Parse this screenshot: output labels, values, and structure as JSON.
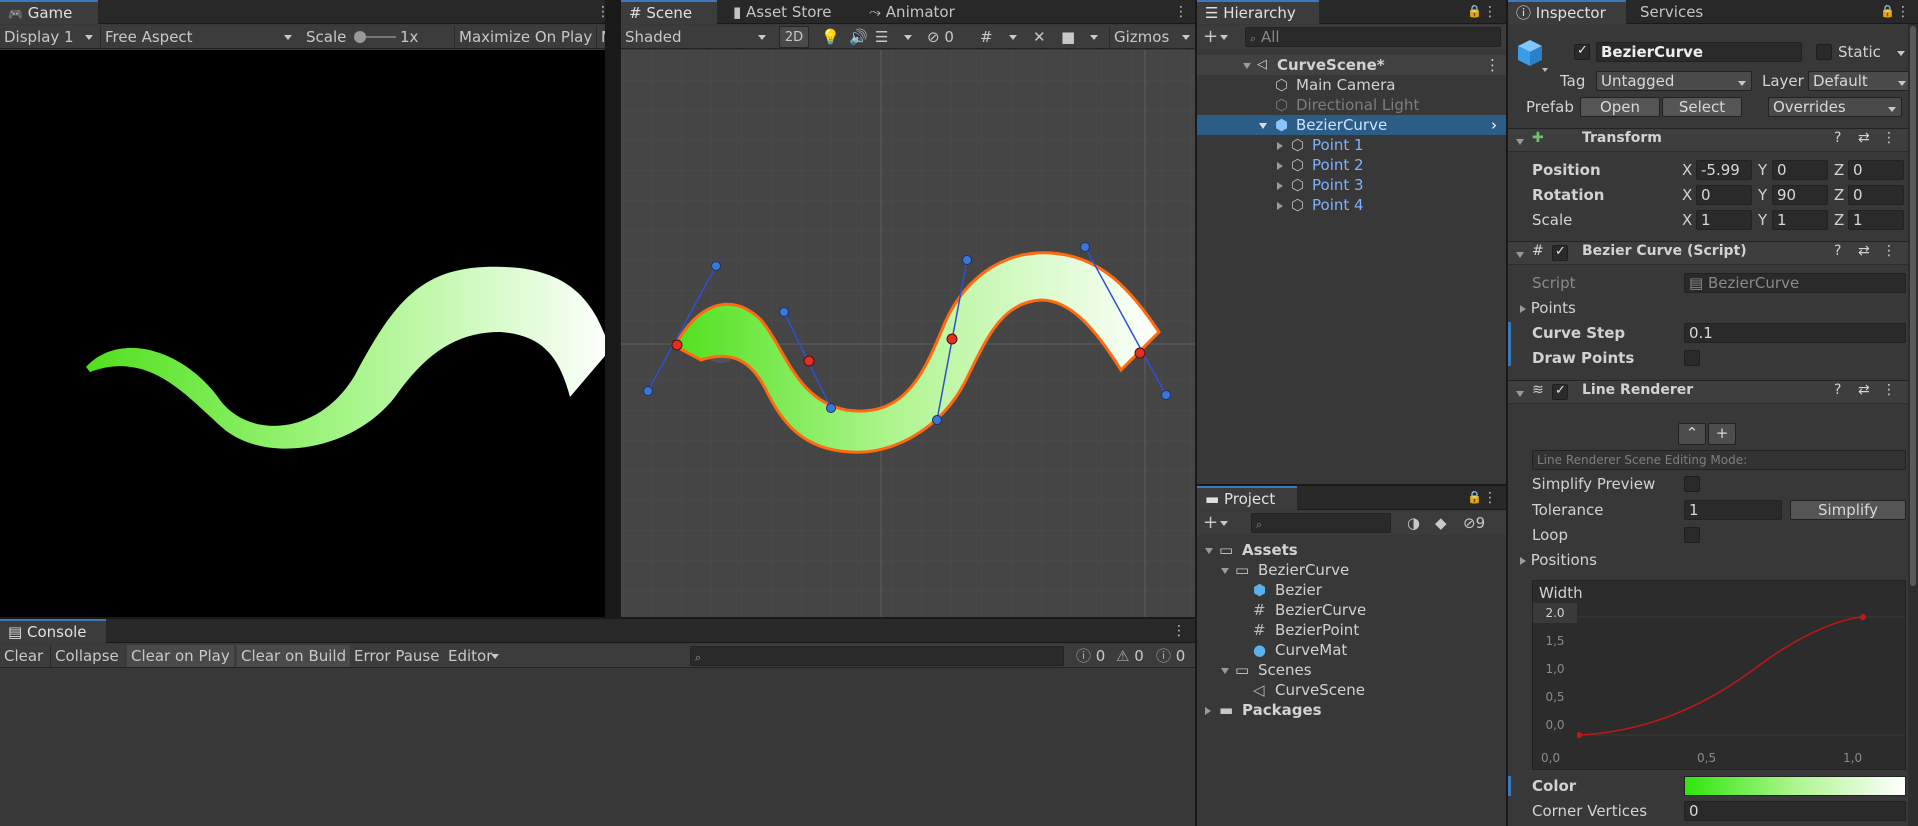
{
  "game": {
    "tab": "Game",
    "display": "Display 1",
    "aspect": "Free Aspect",
    "scale_label": "Scale",
    "scale_value": "1x",
    "maximize": "Maximize On Play",
    "mute_cut": "Mi"
  },
  "scene": {
    "tabs": [
      "Scene",
      "Asset Store",
      "Animator"
    ],
    "shading": "Shaded",
    "mode2d": "2D",
    "hidden_count": "0",
    "gizmos": "Gizmos"
  },
  "console": {
    "tab": "Console",
    "buttons": [
      "Clear",
      "Collapse",
      "Clear on Play",
      "Clear on Build",
      "Error Pause",
      "Editor"
    ],
    "counts": [
      "0",
      "0",
      "0"
    ]
  },
  "hierarchy": {
    "tab": "Hierarchy",
    "search_placeholder": "All",
    "scene_name": "CurveScene*",
    "items": [
      "Main Camera",
      "Directional Light",
      "BezierCurve",
      "Point 1",
      "Point 2",
      "Point 3",
      "Point 4"
    ]
  },
  "project": {
    "tab": "Project",
    "hidden_count": "9",
    "tree": {
      "assets": "Assets",
      "bezier_folder": "BezierCurve",
      "files": [
        "Bezier",
        "BezierCurve",
        "BezierPoint",
        "CurveMat"
      ],
      "scenes_folder": "Scenes",
      "scene_file": "CurveScene",
      "packages": "Packages"
    }
  },
  "inspector": {
    "tabs": [
      "Inspector",
      "Services"
    ],
    "object_name": "BezierCurve",
    "static_label": "Static",
    "tag_label": "Tag",
    "tag_value": "Untagged",
    "layer_label": "Layer",
    "layer_value": "Default",
    "prefab_label": "Prefab",
    "prefab_open": "Open",
    "prefab_select": "Select",
    "prefab_overrides": "Overrides",
    "transform": {
      "title": "Transform",
      "position_label": "Position",
      "rotation_label": "Rotation",
      "scale_label": "Scale",
      "position": {
        "x": "-5.99",
        "y": "0",
        "z": "0"
      },
      "rotation": {
        "x": "0",
        "y": "90",
        "z": "0"
      },
      "scale": {
        "x": "1",
        "y": "1",
        "z": "1"
      },
      "axis": {
        "x": "X",
        "y": "Y",
        "z": "Z"
      }
    },
    "script_comp": {
      "title": "Bezier Curve (Script)",
      "script_label": "Script",
      "script_value": "BezierCurve",
      "points_label": "Points",
      "curve_step_label": "Curve Step",
      "curve_step_value": "0.1",
      "draw_points_label": "Draw Points"
    },
    "line_renderer": {
      "title": "Line Renderer",
      "editing_mode": "Line Renderer Scene Editing Mode:",
      "simplify_preview": "Simplify Preview",
      "tolerance_label": "Tolerance",
      "tolerance_value": "1",
      "simplify_button": "Simplify",
      "loop_label": "Loop",
      "positions_label": "Positions",
      "width_label": "Width",
      "width_max": "2.0",
      "y_ticks": [
        "1,5",
        "1,0",
        "0,5",
        "0,0"
      ],
      "x_ticks": [
        "0,0",
        "0,5",
        "1,0"
      ],
      "color_label": "Color",
      "corner_label": "Corner Vertices",
      "corner_value": "0"
    }
  },
  "colors": {
    "accent_blue": "#3a79bb",
    "selection": "#2c5d87",
    "curve_green": "#5ee62c",
    "prefab_blue": "#7cb2ff",
    "width_curve": "#c01818"
  }
}
